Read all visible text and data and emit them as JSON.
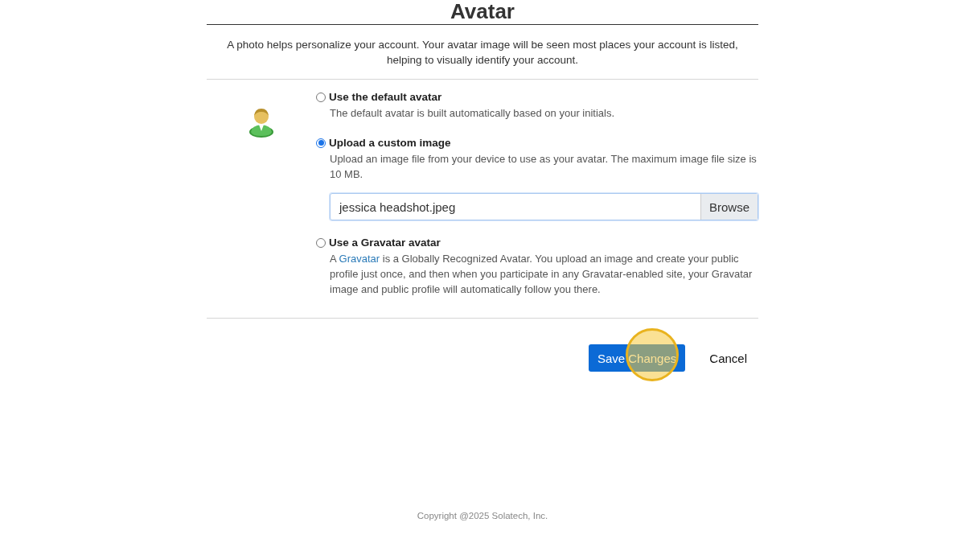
{
  "title": "Avatar",
  "intro": "A photo helps personalize your account. Your avatar image will be seen most places your account is listed, helping to visually identify your account.",
  "options": [
    {
      "label": "Use the default avatar",
      "selected": false,
      "description": [
        {
          "kind": "text",
          "text": "The default avatar is built automatically based on your initials."
        }
      ]
    },
    {
      "label": "Upload a custom image",
      "selected": true,
      "description": [
        {
          "kind": "text",
          "text": "Upload an image file from your device to use as your avatar. The maximum image file size is 10 MB."
        }
      ],
      "file": {
        "value": "jessica headshot.jpeg",
        "button": "Browse"
      }
    },
    {
      "label": "Use a Gravatar avatar",
      "selected": false,
      "description": [
        {
          "kind": "text",
          "text": "A "
        },
        {
          "kind": "link",
          "text": "Gravatar"
        },
        {
          "kind": "text",
          "text": " is a Globally Recognized Avatar. You upload an image and create your public profile just once, and then when you participate in any Gravatar-enabled site, your Gravatar image and public profile will automatically follow you there."
        }
      ]
    }
  ],
  "actions": {
    "save": "Save Changes",
    "cancel": "Cancel",
    "highlight": true
  },
  "footer": "Copyright @2025 Solatech, Inc."
}
